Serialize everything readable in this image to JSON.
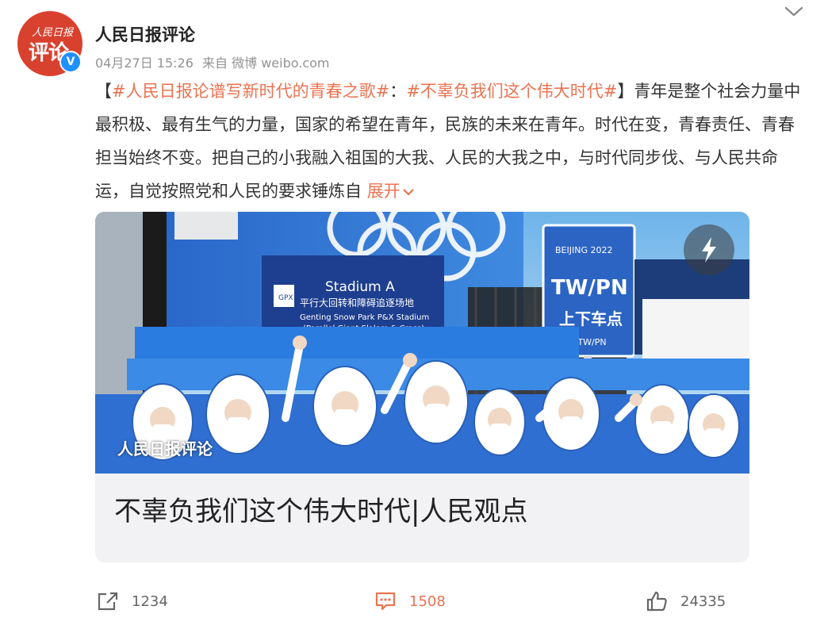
{
  "user": {
    "avatar_small": "人民日报",
    "avatar_big": "评论",
    "verified_mark": "V",
    "name": "人民日报评论",
    "date": "04月27日 15:26",
    "source": "来自 微博 weibo.com"
  },
  "post": {
    "bracket_open": "【",
    "tag1": "#人民日报论谱写新时代的青春之歌#",
    "sep": "：",
    "tag2": "#不辜负我们这个伟大时代#",
    "bracket_close": "】",
    "body": "青年是整个社会力量中最积极、最有生气的力量，国家的希望在青年，民族的未来在青年。时代在变，青春责任、青春担当始终不变。把自己的小我融入祖国的大我、人民的大我之中，与时代同步伐、与人民共命运，自觉按照党和人民的要求锤炼自",
    "expand_label": "展开"
  },
  "card": {
    "title": "不辜负我们这个伟大时代|人民观点",
    "watermark": "人民日报评论",
    "photo": {
      "sign_title": "Stadium A",
      "sign_cn": "平行大回转和障碍追逐场地",
      "sign_en1": "Genting Snow Park P&X Stadium",
      "sign_en2": "(Parallel Giant Slalom & Cross)",
      "sign_logo": "GPX",
      "board_top": "BEIJING 2022",
      "board_main": "TW/PN",
      "board_cn": "上下车点",
      "board_sub": "LZ-TW/PN"
    }
  },
  "actions": {
    "share_count": "1234",
    "comment_count": "1508",
    "like_count": "24335"
  },
  "colors": {
    "accent": "#eb7350",
    "avatar_red": "#d9412f",
    "verified_blue": "#1e90ff",
    "meta_gray": "#939393"
  },
  "icons": [
    "chevron-down-icon",
    "verified-icon",
    "flash-icon",
    "share-icon",
    "comment-icon",
    "like-icon"
  ]
}
